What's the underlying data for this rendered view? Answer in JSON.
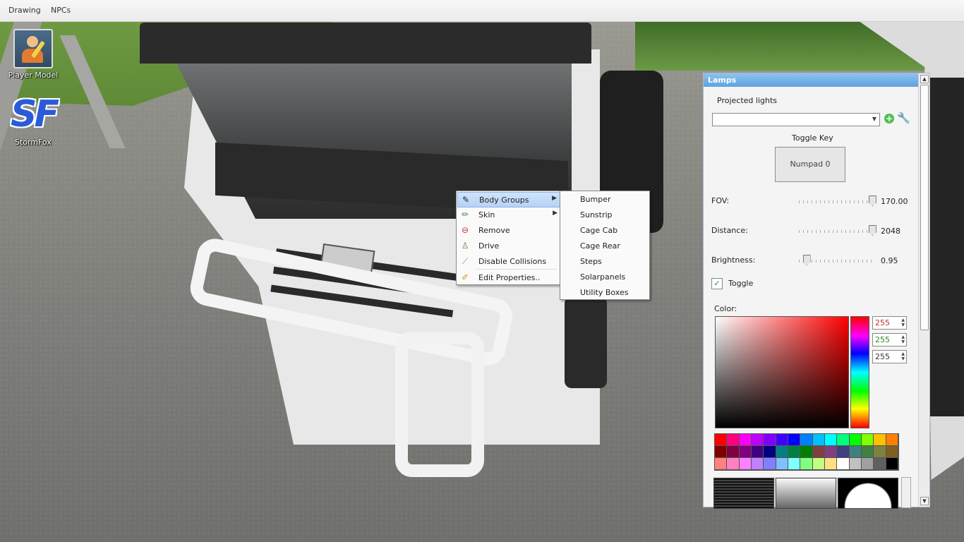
{
  "menubar": {
    "items": [
      "Drawing",
      "NPCs"
    ]
  },
  "desktop": {
    "player_model_label": "Player Model",
    "stormfox_label": "StormFox",
    "stormfox_logo_text": "SF"
  },
  "context_menu": {
    "items": [
      {
        "label": "Body Groups",
        "icon": "body-groups-icon",
        "submenu": true,
        "highlighted": true
      },
      {
        "label": "Skin",
        "icon": "skin-icon",
        "submenu": true
      },
      {
        "label": "Remove",
        "icon": "remove-icon"
      },
      {
        "label": "Drive",
        "icon": "drive-icon"
      },
      {
        "label": "Disable Collisions",
        "icon": "disable-collisions-icon"
      },
      {
        "label": "Edit Properties..",
        "icon": "pencil-icon"
      }
    ],
    "submenu_items": [
      "Bumper",
      "Sunstrip",
      "Cage Cab",
      "Cage Rear",
      "Steps",
      "Solarpanels",
      "Utility Boxes"
    ]
  },
  "panel": {
    "title": "Lamps",
    "projected_lights_label": "Projected lights",
    "projected_lights_value": "",
    "toggle_key_label": "Toggle Key",
    "toggle_key_value": "Numpad 0",
    "fov": {
      "label": "FOV:",
      "value": "170.00",
      "fraction": 0.98
    },
    "distance": {
      "label": "Distance:",
      "value": "2048",
      "fraction": 0.98
    },
    "brightness": {
      "label": "Brightness:",
      "value": "0.95",
      "fraction": 0.1
    },
    "toggle_label": "Toggle",
    "toggle_checked": true,
    "color_label": "Color:",
    "rgb": {
      "r": "255",
      "g": "255",
      "b": "255"
    },
    "accent_color": "#5ea3df",
    "palette": [
      "#ff0000",
      "#ff0080",
      "#ff00ff",
      "#c000ff",
      "#8000ff",
      "#4000ff",
      "#0000ff",
      "#0080ff",
      "#00c0ff",
      "#00ffff",
      "#00ff80",
      "#00ff00",
      "#80ff00",
      "#ffc000",
      "#ff8000",
      "#800000",
      "#800040",
      "#800080",
      "#400080",
      "#000080",
      "#008080",
      "#008040",
      "#008000",
      "#804040",
      "#804080",
      "#404080",
      "#408080",
      "#408040",
      "#808040",
      "#806020",
      "#ff8080",
      "#ff80c0",
      "#ff80ff",
      "#c080ff",
      "#8080ff",
      "#80c0ff",
      "#80ffff",
      "#80ff80",
      "#c0ff80",
      "#ffe080",
      "#ffffff",
      "#c0c0c0",
      "#a0a0a0",
      "#606060",
      "#000000"
    ]
  }
}
